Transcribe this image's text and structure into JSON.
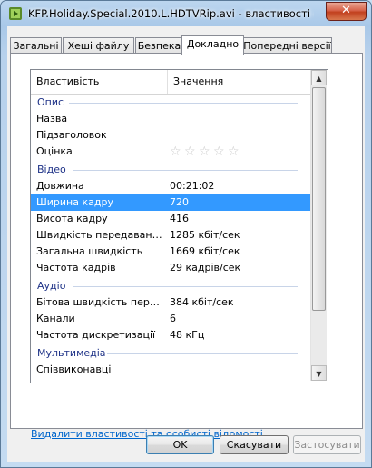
{
  "window": {
    "title": "KFP.Holiday.Special.2010.L.HDTVRip.avi - властивості - [19:...",
    "close_glyph": "✕",
    "icon": "video-file-icon"
  },
  "tabs": [
    {
      "label": "Загальні",
      "active": false
    },
    {
      "label": "Хеші файлу",
      "active": false
    },
    {
      "label": "Безпека",
      "active": false
    },
    {
      "label": "Докладно",
      "active": true
    },
    {
      "label": "Попередні версії",
      "active": false
    }
  ],
  "list": {
    "columns": {
      "property": "Властивість",
      "value": "Значення"
    },
    "groups": {
      "description": "Опис",
      "video": "Відео",
      "audio": "Аудіо",
      "media": "Мультимедіа"
    },
    "rows": {
      "title": {
        "property": "Назва",
        "value": ""
      },
      "subtitle": {
        "property": "Підзаголовок",
        "value": ""
      },
      "rating": {
        "property": "Оцінка",
        "stars": 5,
        "filled": 0,
        "star_glyph": "☆"
      },
      "length": {
        "property": "Довжина",
        "value": "00:21:02"
      },
      "frame_width": {
        "property": "Ширина кадру",
        "value": "720",
        "selected": true
      },
      "frame_height": {
        "property": "Висота кадру",
        "value": "416"
      },
      "data_rate": {
        "property": "Швидкість передавання д...",
        "value": "1285 кбіт/сек"
      },
      "total_bitrate": {
        "property": "Загальна швидкість",
        "value": "1669 кбіт/сек"
      },
      "frame_rate": {
        "property": "Частота кадрів",
        "value": "29 кадрів/сек"
      },
      "audio_bitrate": {
        "property": "Бітова швидкість передав...",
        "value": "384 кбіт/сек"
      },
      "channels": {
        "property": "Канали",
        "value": "6"
      },
      "sample_rate": {
        "property": "Частота дискретизації",
        "value": "48 кГц"
      },
      "contributing_artists": {
        "property": "Співвиконавці",
        "value": ""
      }
    },
    "scroll": {
      "up_glyph": "▲",
      "down_glyph": "▼"
    }
  },
  "remove_link": "Видалити властивості та особисті відомості",
  "buttons": {
    "ok": "OK",
    "cancel": "Скасувати",
    "apply": "Застосувати"
  },
  "colors": {
    "selection": "#3399ff",
    "group_header": "#1e3287",
    "link": "#0066cc"
  }
}
